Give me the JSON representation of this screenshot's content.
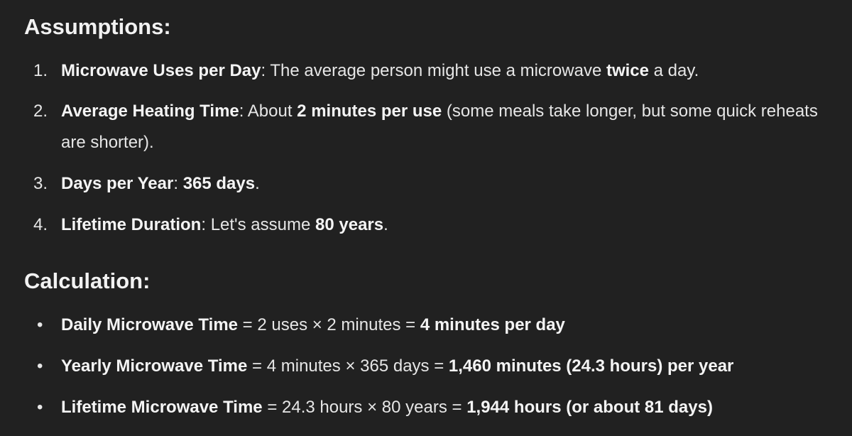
{
  "assumptions": {
    "heading": "Assumptions:",
    "items": [
      {
        "marker": "1.",
        "label": "Microwave Uses per Day",
        "sep": ": ",
        "t1": "The average person might use a microwave ",
        "b1": "twice",
        "t2": " a day."
      },
      {
        "marker": "2.",
        "label": "Average Heating Time",
        "sep": ": ",
        "t1": "About ",
        "b1": "2 minutes per use",
        "t2": " (some meals take longer, but some quick reheats are shorter)."
      },
      {
        "marker": "3.",
        "label": "Days per Year",
        "sep": ": ",
        "b1": "365 days",
        "t2": "."
      },
      {
        "marker": "4.",
        "label": "Lifetime Duration",
        "sep": ": ",
        "t1": "Let's assume ",
        "b1": "80 years",
        "t2": "."
      }
    ]
  },
  "calculation": {
    "heading": "Calculation:",
    "bullet": "•",
    "items": [
      {
        "label": "Daily Microwave Time",
        "expr": " = 2 uses × 2 minutes = ",
        "result": "4 minutes per day"
      },
      {
        "label": "Yearly Microwave Time",
        "expr": " = 4 minutes × 365 days = ",
        "result": "1,460 minutes (24.3 hours) per year"
      },
      {
        "label": "Lifetime Microwave Time",
        "expr": " = 24.3 hours × 80 years = ",
        "result": "1,944 hours (or about 81 days)"
      }
    ]
  }
}
